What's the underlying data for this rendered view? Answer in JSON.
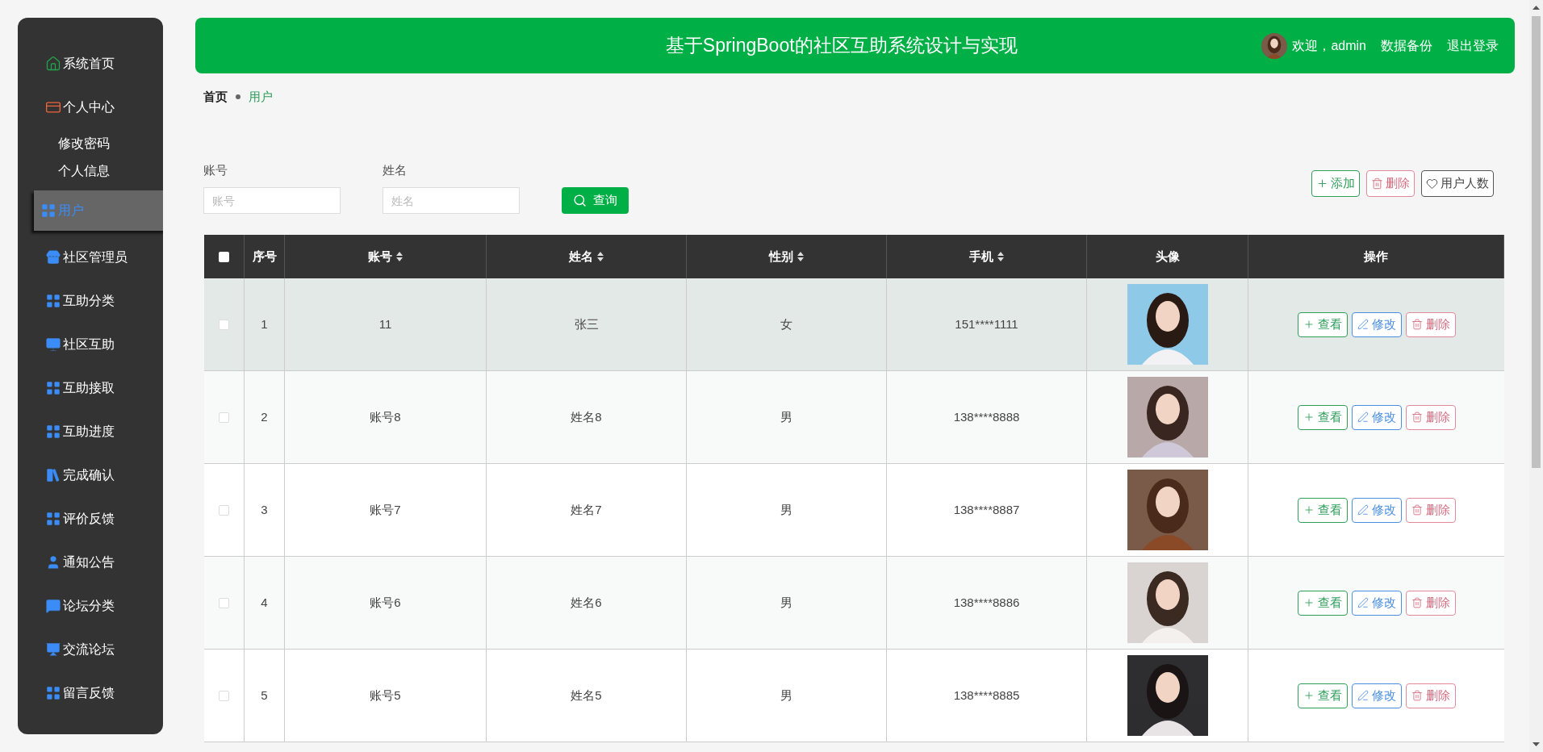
{
  "header": {
    "title": "基于SpringBoot的社区互助系统设计与实现",
    "welcome": "欢迎，admin",
    "links": [
      "数据备份",
      "退出登录"
    ]
  },
  "sidebar": {
    "items": [
      {
        "label": "系统首页",
        "selected": false
      },
      {
        "label": "个人中心",
        "selected": false,
        "children": [
          {
            "label": "修改密码",
            "selected": false
          },
          {
            "label": "个人信息",
            "selected": false
          }
        ]
      },
      {
        "label": "用户",
        "selected": true
      },
      {
        "label": "社区管理员",
        "selected": false
      },
      {
        "label": "互助分类",
        "selected": false
      },
      {
        "label": "社区互助",
        "selected": false
      },
      {
        "label": "互助接取",
        "selected": false
      },
      {
        "label": "互助进度",
        "selected": false
      },
      {
        "label": "完成确认",
        "selected": false
      },
      {
        "label": "评价反馈",
        "selected": false
      },
      {
        "label": "通知公告",
        "selected": false
      },
      {
        "label": "论坛分类",
        "selected": false
      },
      {
        "label": "交流论坛",
        "selected": false
      },
      {
        "label": "留言反馈",
        "selected": false
      }
    ]
  },
  "breadcrumb": [
    "首页",
    "用户"
  ],
  "search": {
    "fields": [
      {
        "label": "账号",
        "placeholder": "账号"
      },
      {
        "label": "姓名",
        "placeholder": "姓名"
      }
    ],
    "button": "查询"
  },
  "toolbar": [
    {
      "kind": "add",
      "label": "添加"
    },
    {
      "kind": "delete",
      "label": "删除"
    },
    {
      "kind": "stats",
      "label": "用户人数"
    }
  ],
  "table": {
    "all_checked": false,
    "columns": [
      {
        "label": "序号",
        "sortable": false
      },
      {
        "label": "账号",
        "sortable": true
      },
      {
        "label": "姓名",
        "sortable": true
      },
      {
        "label": "性别",
        "sortable": true
      },
      {
        "label": "手机",
        "sortable": true
      },
      {
        "label": "头像",
        "sortable": false
      },
      {
        "label": "操作",
        "sortable": false
      }
    ],
    "rows": [
      {
        "index": "1",
        "account": "11",
        "name": "张三",
        "gender": "女",
        "phone": "151****1111",
        "highlighted": true,
        "checked": false,
        "actions": [
          {
            "kind": "view",
            "label": "查看"
          },
          {
            "kind": "edit",
            "label": "修改"
          },
          {
            "kind": "delete",
            "label": "删除"
          }
        ]
      },
      {
        "index": "2",
        "account": "账号8",
        "name": "姓名8",
        "gender": "男",
        "phone": "138****8888",
        "highlighted": false,
        "checked": false,
        "actions": [
          {
            "kind": "view",
            "label": "查看"
          },
          {
            "kind": "edit",
            "label": "修改"
          },
          {
            "kind": "delete",
            "label": "删除"
          }
        ]
      },
      {
        "index": "3",
        "account": "账号7",
        "name": "姓名7",
        "gender": "男",
        "phone": "138****8887",
        "highlighted": false,
        "checked": false,
        "actions": [
          {
            "kind": "view",
            "label": "查看"
          },
          {
            "kind": "edit",
            "label": "修改"
          },
          {
            "kind": "delete",
            "label": "删除"
          }
        ]
      },
      {
        "index": "4",
        "account": "账号6",
        "name": "姓名6",
        "gender": "男",
        "phone": "138****8886",
        "highlighted": false,
        "checked": false,
        "actions": [
          {
            "kind": "view",
            "label": "查看"
          },
          {
            "kind": "edit",
            "label": "修改"
          },
          {
            "kind": "delete",
            "label": "删除"
          }
        ]
      },
      {
        "index": "5",
        "account": "账号5",
        "name": "姓名5",
        "gender": "男",
        "phone": "138****8885",
        "highlighted": false,
        "checked": false,
        "actions": [
          {
            "kind": "view",
            "label": "查看"
          },
          {
            "kind": "edit",
            "label": "修改"
          },
          {
            "kind": "delete",
            "label": "删除"
          }
        ]
      }
    ]
  }
}
